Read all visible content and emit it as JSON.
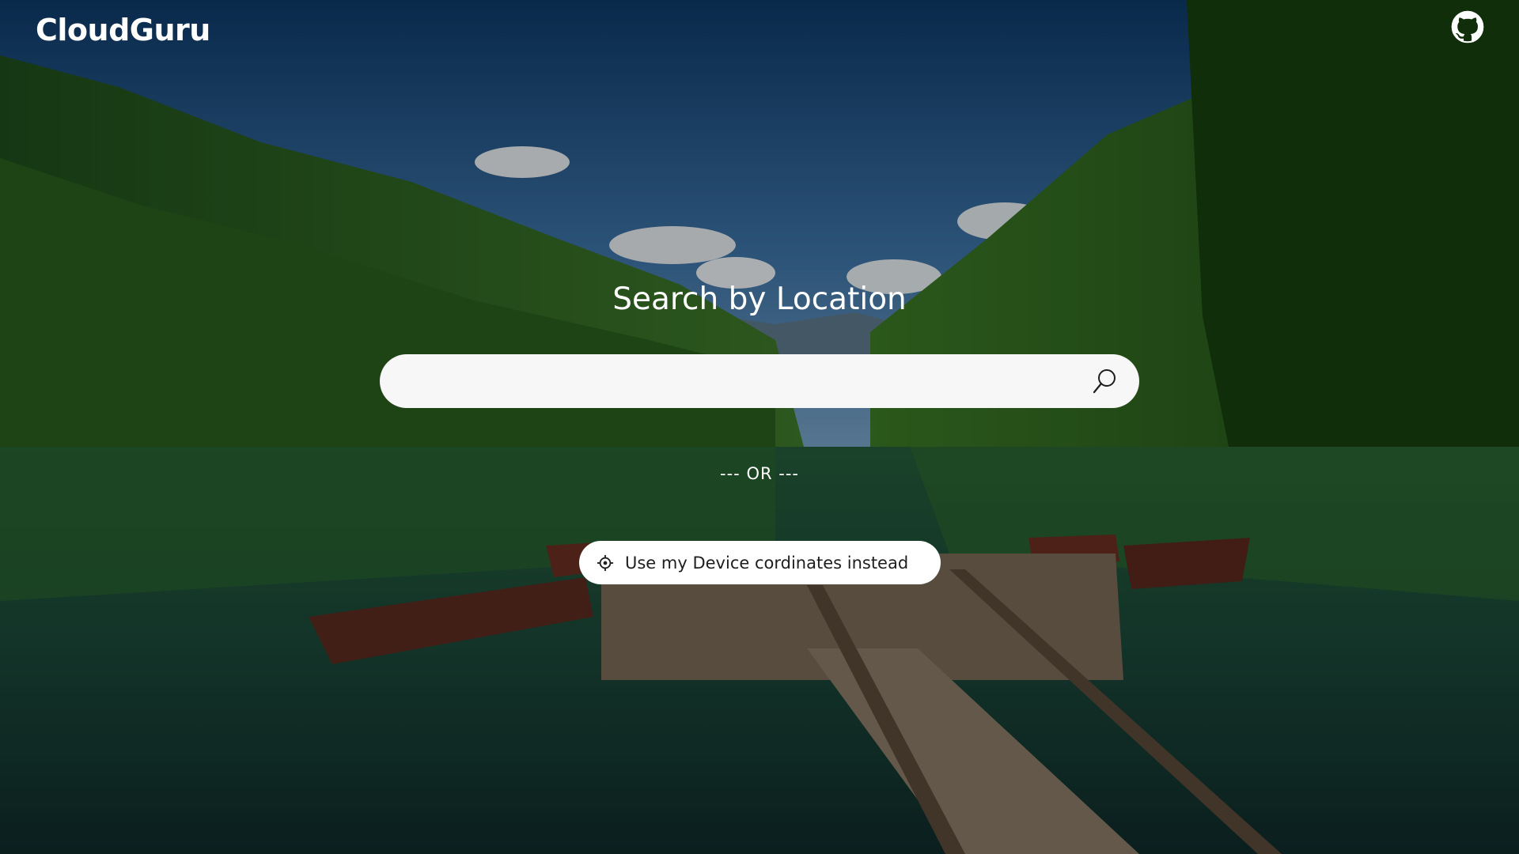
{
  "brand": {
    "name": "CloudGuru"
  },
  "header": {
    "github_icon": "github-icon"
  },
  "hero": {
    "title": "Search by Location"
  },
  "search": {
    "value": "",
    "placeholder": "",
    "icon": "search-icon"
  },
  "divider": {
    "text": "--- OR ---"
  },
  "device_button": {
    "label": "Use my Device cordinates instead",
    "icon": "location-crosshair-icon"
  },
  "background": {
    "scene": "mountain-lake-dock-image"
  },
  "colors": {
    "text": "#ffffff",
    "search_bg": "#f7f7f7",
    "button_bg": "#ffffff",
    "button_text": "#1e1e1e"
  }
}
